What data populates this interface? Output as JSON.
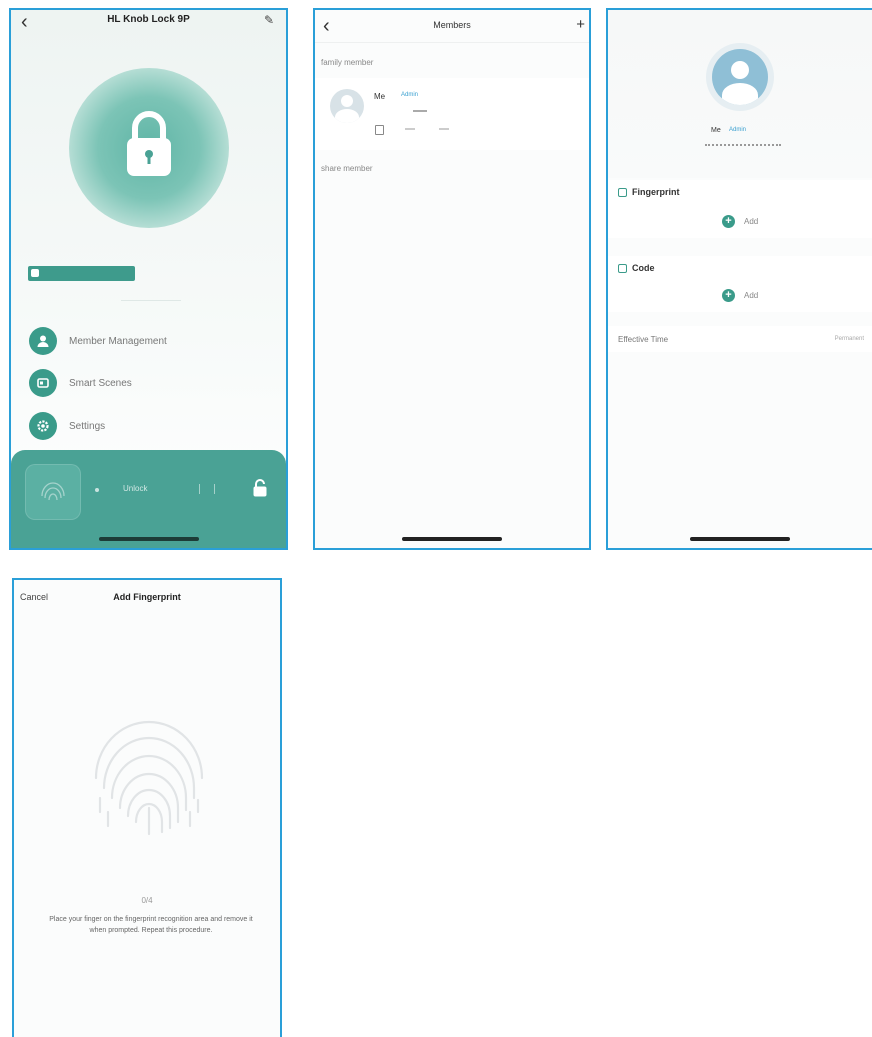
{
  "screen1": {
    "title": "HL Knob Lock 9P",
    "subtitle": "",
    "menu": [
      {
        "label": "Member Management",
        "icon": "person-icon"
      },
      {
        "label": "Smart Scenes",
        "icon": "scene-icon"
      },
      {
        "label": "Settings",
        "icon": "gear-icon"
      }
    ],
    "bottom_text": "Unlock",
    "colors": {
      "accent": "#3a9b8a",
      "panel": "#4aa295"
    }
  },
  "screen2": {
    "title": "Members",
    "family_section": "family member",
    "member_name": "Me",
    "member_role": "Admin",
    "share_section": "share member"
  },
  "screen3": {
    "member_name": "Me",
    "member_role": "Admin",
    "fingerprint_label": "Fingerprint",
    "code_label": "Code",
    "add_label": "Add",
    "effective_time_label": "Effective Time",
    "effective_time_value": "Permanent"
  },
  "screen4": {
    "cancel_label": "Cancel",
    "title": "Add Fingerprint",
    "progress": "0/4",
    "instruction": "Place your finger on the fingerprint recognition area and remove it when prompted. Repeat this procedure."
  }
}
